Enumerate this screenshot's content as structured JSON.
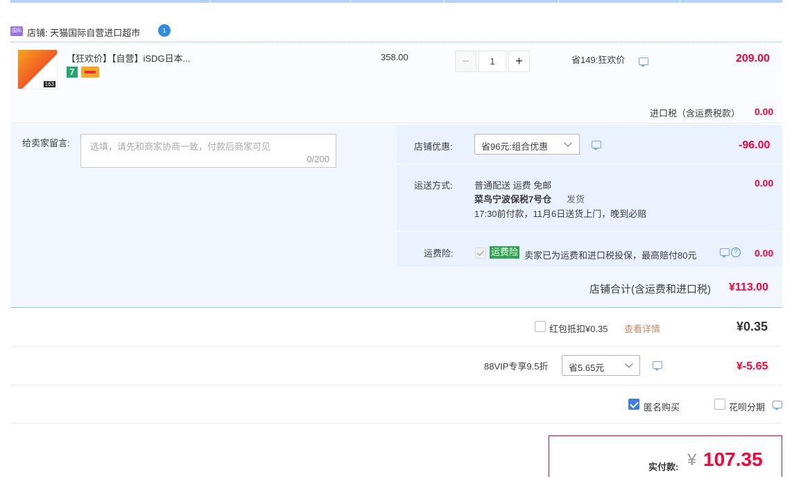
{
  "shop": {
    "label": "店铺: 天猫国际自营进口超市",
    "icon_text": "国际",
    "chat_count": "1"
  },
  "item": {
    "title": "【狂欢价】【自营】iSDG日本...",
    "thumb_badge": "163",
    "tag_seven": "7",
    "unit_price": "358.00",
    "quantity": "1",
    "minus_label": "−",
    "plus_label": "+",
    "discount_label": "省149:狂欢价",
    "subtotal": "209.00",
    "import_tax_label": "进口税（含运费税款）",
    "import_tax_value": "0.00"
  },
  "memo": {
    "label": "给卖家留言:",
    "placeholder": "选填，请先和商家协商一致，付款后商家可见",
    "counter": "0/200"
  },
  "shop_discount": {
    "label": "店铺优惠:",
    "selected": "省96元:组合优惠",
    "value": "-96.00"
  },
  "shipping": {
    "label": "运送方式:",
    "line1": "普通配送 运费 免邮",
    "warehouse": "菜鸟宁波保税7号仓",
    "ship_text": "发货",
    "line3": "17:30前付款，11月6日送货上门，晚到必赔",
    "value": "0.00"
  },
  "insurance": {
    "label": "运费险:",
    "badge": "运费险",
    "text": "卖家已为运费和进口税投保，最高赔付80元",
    "help": "?",
    "value": "0.00"
  },
  "shop_total": {
    "label": "店铺合计(含运费和进口税)",
    "value": "¥113.00"
  },
  "redpacket": {
    "label": "红包抵扣¥0.35",
    "link": "查看详情",
    "value": "¥0.35"
  },
  "vip": {
    "label": "88VIP专享9.5折",
    "selected": "省5.65元",
    "value": "¥-5.65"
  },
  "options": {
    "anonymous": "匿名购买",
    "anonymous_checked": true,
    "huabei": "花呗分期",
    "huabei_checked": false
  },
  "pay": {
    "label": "实付款:",
    "currency": "¥",
    "amount": "107.35"
  },
  "colors": {
    "price_red": "#ff0036",
    "accent_blue": "#3a7ee4",
    "insurance_green": "#2da74e"
  }
}
